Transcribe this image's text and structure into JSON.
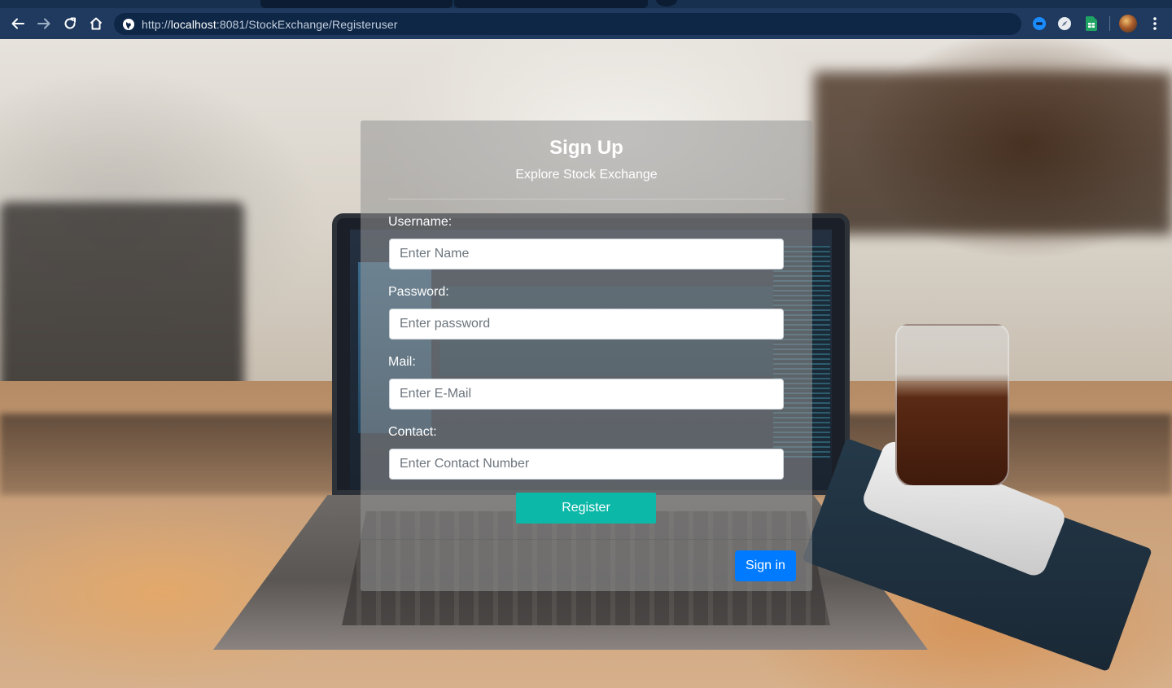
{
  "browser": {
    "url_scheme": "http://",
    "url_host": "localhost",
    "url_rest": ":8081/StockExchange/Registeruser",
    "icons": {
      "back": "arrow-left-icon",
      "forward": "arrow-right-icon",
      "reload": "reload-icon",
      "home": "home-icon",
      "site_info": "globe-icon",
      "menu": "kebab-menu-icon"
    }
  },
  "signup": {
    "title": "Sign Up",
    "subtitle": "Explore Stock Exchange",
    "fields": {
      "username": {
        "label": "Username:",
        "placeholder": "Enter Name",
        "value": ""
      },
      "password": {
        "label": "Password:",
        "placeholder": "Enter password",
        "value": ""
      },
      "mail": {
        "label": "Mail:",
        "placeholder": "Enter E-Mail",
        "value": ""
      },
      "contact": {
        "label": "Contact:",
        "placeholder": "Enter Contact Number",
        "value": ""
      }
    },
    "register_label": "Register",
    "signin_label": "Sign in"
  },
  "colors": {
    "register_button": "#0cb8a8",
    "signin_button": "#007bff",
    "browser_frame": "#1f3a5e"
  }
}
